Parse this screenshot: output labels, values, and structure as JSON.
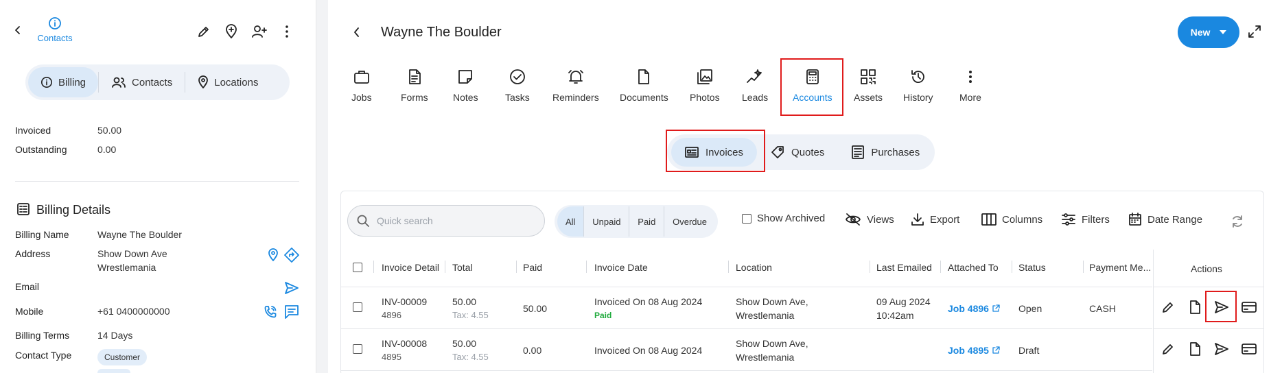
{
  "left": {
    "header_label": "Contacts",
    "seg_tabs": [
      {
        "label": "Billing"
      },
      {
        "label": "Contacts"
      },
      {
        "label": "Locations"
      }
    ],
    "summary": [
      {
        "label": "Invoiced",
        "value": "50.00"
      },
      {
        "label": "Outstanding",
        "value": "0.00"
      }
    ],
    "billing_details_title": "Billing Details",
    "billing": {
      "name_label": "Billing Name",
      "name": "Wayne The Boulder",
      "address_label": "Address",
      "address_line1": "Show Down Ave",
      "address_line2": "Wrestlemania",
      "email_label": "Email",
      "mobile_label": "Mobile",
      "mobile": "+61 0400000000",
      "terms_label": "Billing Terms",
      "terms": "14 Days",
      "contact_type_label": "Contact Type",
      "contact_type": "Customer"
    }
  },
  "right": {
    "title": "Wayne The Boulder",
    "new_button": "New",
    "nav": [
      {
        "label": "Jobs"
      },
      {
        "label": "Forms"
      },
      {
        "label": "Notes"
      },
      {
        "label": "Tasks"
      },
      {
        "label": "Reminders"
      },
      {
        "label": "Documents"
      },
      {
        "label": "Photos"
      },
      {
        "label": "Leads"
      },
      {
        "label": "Accounts"
      },
      {
        "label": "Assets"
      },
      {
        "label": "History"
      },
      {
        "label": "More"
      }
    ],
    "sub_tabs": [
      {
        "label": "Invoices"
      },
      {
        "label": "Quotes"
      },
      {
        "label": "Purchases"
      }
    ],
    "search_placeholder": "Quick search",
    "filters": [
      "All",
      "Unpaid",
      "Paid",
      "Overdue"
    ],
    "tools": {
      "show_archived": "Show Archived",
      "views": "Views",
      "export": "Export",
      "columns": "Columns",
      "filters": "Filters",
      "date_range": "Date Range"
    },
    "columns": [
      "Invoice Detail",
      "Total",
      "Paid",
      "Invoice Date",
      "Location",
      "Last Emailed",
      "Attached To",
      "Status",
      "Payment Me...",
      "Actions"
    ],
    "rows": [
      {
        "invoice": "INV-00009",
        "invoice_sub": "4896",
        "total": "50.00",
        "tax": "Tax: 4.55",
        "paid": "50.00",
        "date": "Invoiced On 08 Aug 2024",
        "date_tag": "Paid",
        "loc1": "Show Down Ave,",
        "loc2": "Wrestlemania",
        "emailed1": "09 Aug 2024",
        "emailed2": "10:42am",
        "attached": "Job 4896",
        "status": "Open",
        "payment": "CASH"
      },
      {
        "invoice": "INV-00008",
        "invoice_sub": "4895",
        "total": "50.00",
        "tax": "Tax: 4.55",
        "paid": "0.00",
        "date": "Invoiced On 08 Aug 2024",
        "date_tag": "",
        "loc1": "Show Down Ave,",
        "loc2": "Wrestlemania",
        "emailed1": "",
        "emailed2": "",
        "attached": "Job 4895",
        "status": "Draft",
        "payment": ""
      }
    ],
    "colors": {
      "accent": "#1a88e0",
      "highlight": "#e01b1b",
      "paid": "#1faa3c"
    }
  }
}
